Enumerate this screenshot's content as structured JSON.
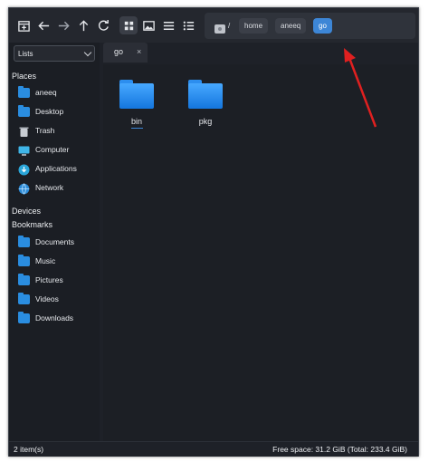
{
  "toolbar": {
    "buttons": [
      {
        "name": "new-tab-icon"
      },
      {
        "name": "back-arrow-icon"
      },
      {
        "name": "forward-arrow-icon"
      },
      {
        "name": "up-arrow-icon"
      },
      {
        "name": "reload-icon"
      },
      {
        "name": "grid-view-icon",
        "active": true
      },
      {
        "name": "image-view-icon"
      },
      {
        "name": "list-view-icon"
      },
      {
        "name": "detailed-list-icon"
      }
    ]
  },
  "pathbar": {
    "root_label": "/",
    "segments": [
      "home",
      "aneeq"
    ],
    "current": "go"
  },
  "sidebar": {
    "dropdown_value": "Lists",
    "places_heading": "Places",
    "places": [
      {
        "label": "aneeq",
        "icon": "home-folder-icon"
      },
      {
        "label": "Desktop",
        "icon": "folder-icon"
      },
      {
        "label": "Trash",
        "icon": "trash-icon"
      },
      {
        "label": "Computer",
        "icon": "computer-icon"
      },
      {
        "label": "Applications",
        "icon": "applications-icon"
      },
      {
        "label": "Network",
        "icon": "network-icon"
      }
    ],
    "devices_heading": "Devices",
    "bookmarks_heading": "Bookmarks",
    "bookmarks": [
      {
        "label": "Documents",
        "icon": "documents-folder-icon"
      },
      {
        "label": "Music",
        "icon": "music-folder-icon"
      },
      {
        "label": "Pictures",
        "icon": "pictures-folder-icon"
      },
      {
        "label": "Videos",
        "icon": "videos-folder-icon"
      },
      {
        "label": "Downloads",
        "icon": "downloads-folder-icon"
      }
    ]
  },
  "tab": {
    "label": "go",
    "close": "×"
  },
  "files": [
    {
      "name": "bin"
    },
    {
      "name": "pkg"
    }
  ],
  "status": {
    "items": "2 item(s)",
    "free_space": "Free space: 31.2 GiB (Total: 233.4 GiB)"
  },
  "colors": {
    "accent": "#3d86d6",
    "folder": "#2a8de0",
    "annotation_arrow": "#e02020"
  }
}
